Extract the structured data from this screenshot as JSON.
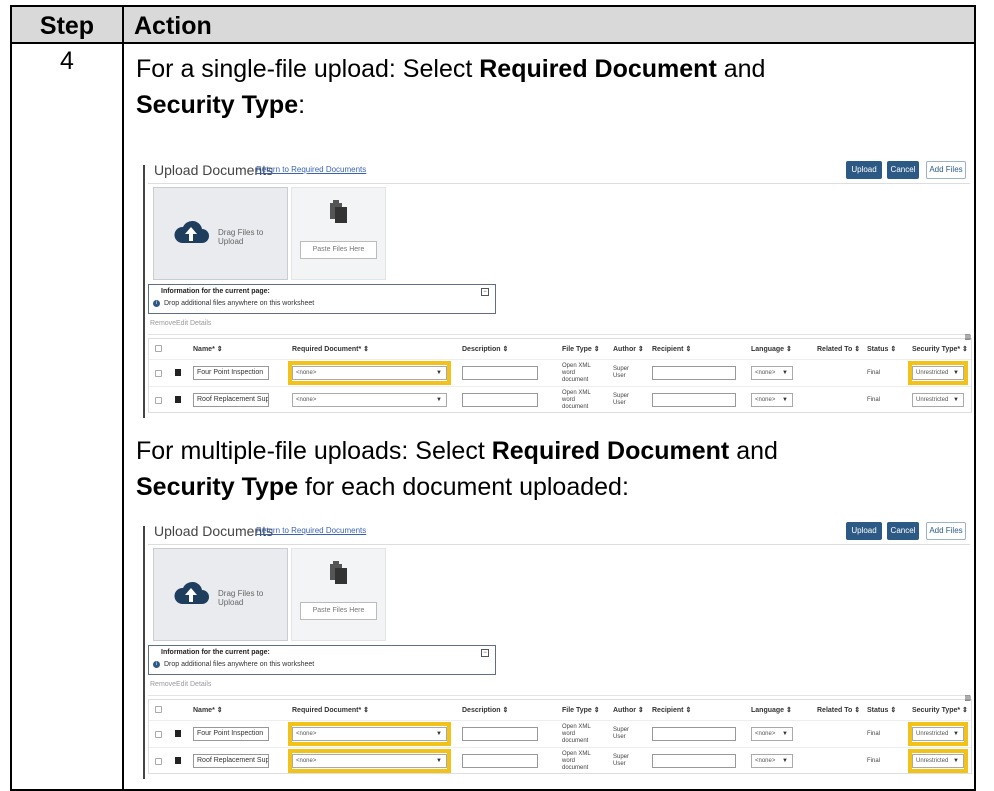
{
  "table": {
    "header_step": "Step",
    "header_action": "Action",
    "step_number": "4"
  },
  "captions": {
    "single_prefix": "For a single-file upload: Select ",
    "single_b1": "Required Document",
    "single_mid": " and",
    "single_b2": "Security Type",
    "single_end": ":",
    "multi_prefix": "For multiple-file uploads: Select ",
    "multi_b1": "Required Document",
    "multi_mid": " and",
    "multi_b2": "Security Type",
    "multi_end": " for each document uploaded:"
  },
  "screenshot": {
    "title": "Upload Documents",
    "return_link": "Return to Required Documents",
    "btn_upload": "Upload",
    "btn_cancel": "Cancel",
    "btn_add": "Add Files",
    "drop_text": "Drag Files to Upload",
    "paste_text": "Paste Files Here",
    "info_title": "Information for the current page:",
    "info_msg": "Drop additional files anywhere on this worksheet",
    "toolbar_remove": "Remove",
    "toolbar_edit": "Edit Details",
    "columns": {
      "name": "Name* ⇕",
      "required_doc": "Required Document* ⇕",
      "description": "Description ⇕",
      "file_type": "File Type ⇕",
      "author": "Author ⇕",
      "recipient": "Recipient ⇕",
      "language": "Language ⇕",
      "related_to": "Related To ⇕",
      "status": "Status ⇕",
      "security_type": "Security Type* ⇕"
    },
    "rows": [
      {
        "name": "Four Point Inspection",
        "required_doc": "<none>",
        "file_type_1": "Open XML",
        "file_type_2": "word",
        "file_type_3": "document",
        "author_1": "Super",
        "author_2": "User",
        "language": "<none>",
        "status": "Final",
        "security_type": "Unrestricted"
      },
      {
        "name": "Roof Replacement Support",
        "required_doc": "<none>",
        "file_type_1": "Open XML",
        "file_type_2": "word",
        "file_type_3": "document",
        "author_1": "Super",
        "author_2": "User",
        "language": "<none>",
        "status": "Final",
        "security_type": "Unrestricted"
      }
    ]
  },
  "highlight_color": "#f1c21a",
  "icons": [
    "cloud-upload-icon",
    "documents-icon",
    "info-icon",
    "collapse-icon",
    "document-icon",
    "chevron-down-icon"
  ]
}
